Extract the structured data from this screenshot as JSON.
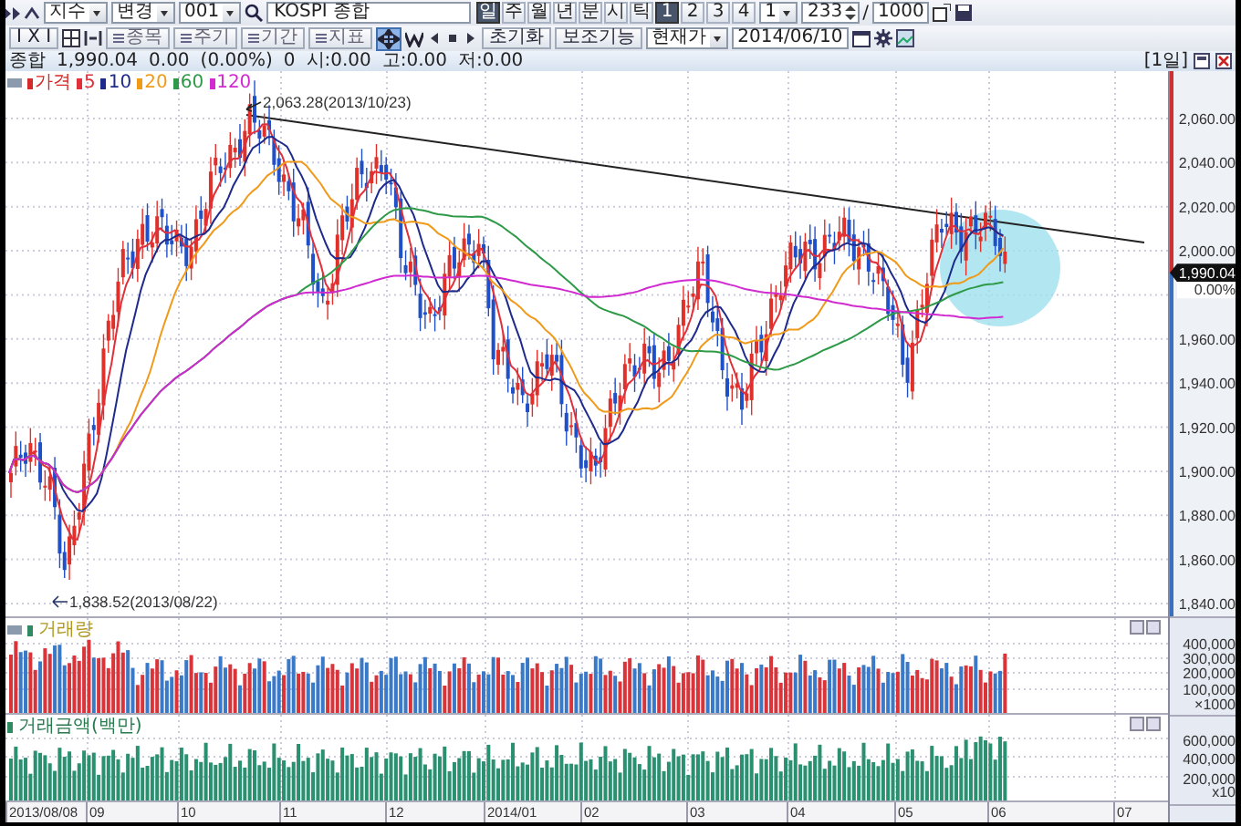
{
  "toolbar_top": {
    "market": "지수",
    "action": "변경",
    "code": "001",
    "name": "KOSPI 종합",
    "periods": [
      {
        "label": "일",
        "selected": true
      },
      {
        "label": "주",
        "selected": false
      },
      {
        "label": "월",
        "selected": false
      },
      {
        "label": "년",
        "selected": false
      },
      {
        "label": "분",
        "selected": false
      },
      {
        "label": "시",
        "selected": false
      },
      {
        "label": "틱",
        "selected": false
      }
    ],
    "multipliers": [
      {
        "label": "1",
        "selected": true
      },
      {
        "label": "2",
        "selected": false
      },
      {
        "label": "3",
        "selected": false
      },
      {
        "label": "4",
        "selected": false
      }
    ],
    "unit": "1",
    "count": "233",
    "separator": "/",
    "max_count": "1000"
  },
  "toolbar_bottom": {
    "layout": "I X I",
    "tools": [
      "종목",
      "주기",
      "기간",
      "지표"
    ],
    "pan_mode_on": true,
    "reset": "초기화",
    "assist": "보조기능",
    "price_type": "현재가",
    "date": "2014/06/10"
  },
  "header": {
    "name": "종합",
    "price": "1,990.04",
    "change": "0.00",
    "change_rate": "(0.00%)",
    "volume": "0",
    "open": "시:0.00",
    "high": "고:0.00",
    "low": "저:0.00",
    "period": "[1일]"
  },
  "price_pane": {
    "legend": [
      {
        "label": "가격",
        "color": "#d42a2a"
      },
      {
        "label": "5",
        "color": "#e0303a"
      },
      {
        "label": "10",
        "color": "#1e2a8c"
      },
      {
        "label": "20",
        "color": "#f09a1a"
      },
      {
        "label": "60",
        "color": "#2e9a48"
      },
      {
        "label": "120",
        "color": "#d02ad0"
      }
    ],
    "high_marker": "2,063.28(2013/10/23)",
    "low_marker": "1,838.52(2013/08/22)",
    "y_ticks": [
      "2,060.00",
      "2,040.00",
      "2,020.00",
      "2,000.00",
      "1,960.00",
      "1,940.00",
      "1,920.00",
      "1,900.00",
      "1,880.00",
      "1,860.00",
      "1,840.00"
    ],
    "current_price": "1,990.04",
    "current_change": "0.00%"
  },
  "volume_pane": {
    "title": "거래량",
    "y_ticks": [
      "400,000",
      "300,000",
      "200,000",
      "100,000"
    ],
    "unit": "×1000"
  },
  "amount_pane": {
    "title": "거래금액(백만)",
    "y_ticks": [
      "600,000",
      "400,000",
      "200,000"
    ],
    "unit": "x10"
  },
  "x_axis": [
    "2013/08/08",
    "09",
    "10",
    "11",
    "12",
    "2014/01",
    "02",
    "03",
    "04",
    "05",
    "06",
    "07"
  ]
}
